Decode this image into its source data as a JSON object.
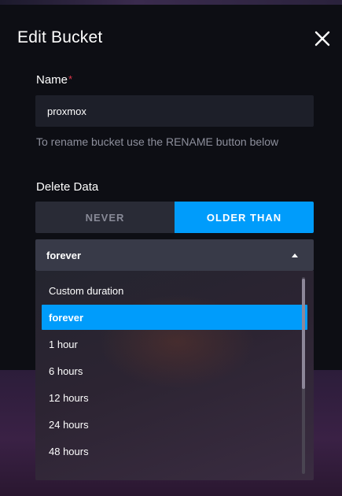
{
  "modal": {
    "title": "Edit Bucket",
    "name_label": "Name",
    "required_mark": "*",
    "name_value": "proxmox",
    "rename_hint": "To rename bucket use the RENAME button below",
    "delete_label": "Delete Data"
  },
  "delete_toggle": {
    "options": [
      {
        "label": "NEVER",
        "selected": false
      },
      {
        "label": "OLDER THAN",
        "selected": true
      }
    ]
  },
  "duration_select": {
    "selected": "forever",
    "open": true,
    "options": [
      {
        "label": "Custom duration"
      },
      {
        "label": "forever"
      },
      {
        "label": "1 hour"
      },
      {
        "label": "6 hours"
      },
      {
        "label": "12 hours"
      },
      {
        "label": "24 hours"
      },
      {
        "label": "48 hours"
      }
    ]
  },
  "colors": {
    "accent": "#009cfb",
    "required": "#e1374b",
    "modal_bg": "#0d0e14",
    "input_bg": "#1d1f29"
  },
  "icons": {
    "close": "close-icon",
    "caret": "caret-up-icon"
  }
}
